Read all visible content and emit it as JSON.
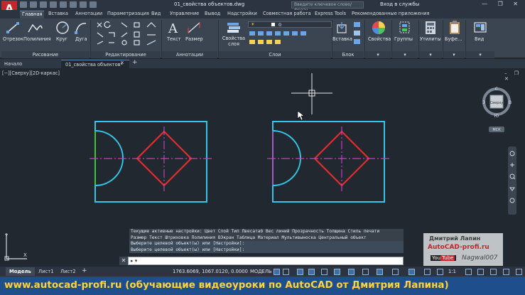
{
  "title_bar": {
    "app_logo": "A",
    "doc_title": "01_свойства объектов.dwg",
    "search_placeholder": "Введите ключевое слово/фразу",
    "login": "Вход в службы",
    "window_controls": "— ❐ ✕"
  },
  "ribbon_tabs": [
    "Главная",
    "Вставка",
    "Аннотации",
    "Параметризация",
    "Вид",
    "Управление",
    "Вывод",
    "Надстройки",
    "Совместная работа",
    "Express Tools",
    "Рекомендованные приложения"
  ],
  "ribbon": {
    "draw_tools": [
      "Отрезок",
      "Полилиния",
      "Круг",
      "Дуга"
    ],
    "draw_panel": "Рисование",
    "modify_panel": "Редактирование",
    "annotation_tools": [
      "Текст",
      "Размер"
    ],
    "annotation_panel": "Аннотации",
    "layer_props": "Свойства слоя",
    "layer_name": "0",
    "layers_panel": "Слои",
    "insert": "Вставка",
    "block_panel": "Блок",
    "properties": "Свойства",
    "groups": "Группы",
    "utilities": "Утилиты",
    "clipboard": "Буфе...",
    "view": "Вид"
  },
  "file_tabs": [
    "Начало",
    "01_свойства объектов*"
  ],
  "viewport_label": "[−][Сверху][2D-каркас]",
  "viewcube": {
    "top": "С",
    "bottom": "Ю",
    "left": "З",
    "right": "В",
    "face": "Сверху",
    "ucs": "МСК"
  },
  "command_history": [
    "Текущие активные настройки:  Цвет Слой Тип Лвесатаб Вес линий Прозрачность Толщина Стиль печати",
    "Размер Текст Штриховка Полилиния ВЭкран Таблица Материал Мультивыноска Центральный объект",
    "Выберите целевой объект(ы) или [Настройки]:",
    "Выберите целевой объект(ы) или [Настройки]:"
  ],
  "command_input": "",
  "ucs_labels": {
    "x": "X",
    "y": "Y"
  },
  "watermark": {
    "name": "Дмитрий Лапин",
    "site": "AutoCAD-profi.ru",
    "you": "You",
    "tube": "Tube",
    "channel": "Nagwal007"
  },
  "layout_tabs": [
    "Модель",
    "Лист1",
    "Лист2"
  ],
  "status": {
    "coords": "1763.6069, 1067.0120, 0.0000",
    "model": "МОДЕЛЬ",
    "scale": "1:1"
  },
  "footer": "www.autocad-profi.ru  (обучающие видеоуроки по AutoCAD от Дмитрия Лапина)",
  "colors": {
    "rect": "#33c6e6",
    "diamond": "#e12d2d",
    "centerline": "#c040c0",
    "highlight_line": "#3cc83c",
    "background": "#212830"
  }
}
